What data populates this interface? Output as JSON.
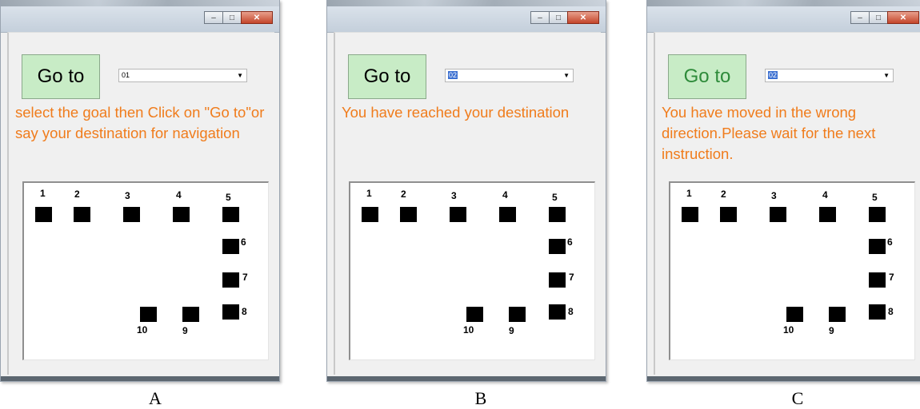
{
  "panels": [
    {
      "caption": "A",
      "window": {
        "minimize_icon": "minimize-icon",
        "maximize_icon": "maximize-icon",
        "close_icon": "close-icon"
      },
      "goto_label": "Go to",
      "goto_color": "#000000",
      "destination_select": {
        "value": "01",
        "highlighted": false
      },
      "message": "select the goal then Click on \"Go to\"or say your destination for navigation",
      "message_color": "#f07c1c"
    },
    {
      "caption": "B",
      "window": {
        "minimize_icon": "minimize-icon",
        "maximize_icon": "maximize-icon",
        "close_icon": "close-icon"
      },
      "goto_label": "Go to",
      "goto_color": "#000000",
      "destination_select": {
        "value": "02",
        "highlighted": true
      },
      "message": "You have reached your destination",
      "message_color": "#f07c1c"
    },
    {
      "caption": "C",
      "window": {
        "minimize_icon": "minimize-icon",
        "maximize_icon": "maximize-icon",
        "close_icon": "close-icon"
      },
      "goto_label": "Go to",
      "goto_color": "#2e8b3a",
      "destination_select": {
        "value": "02",
        "highlighted": true
      },
      "message": "You have moved in the wrong direction.Please wait for the next instruction.",
      "message_color": "#f07c1c"
    }
  ],
  "map_nodes": [
    "1",
    "2",
    "3",
    "4",
    "5",
    "6",
    "7",
    "8",
    "9",
    "10"
  ]
}
